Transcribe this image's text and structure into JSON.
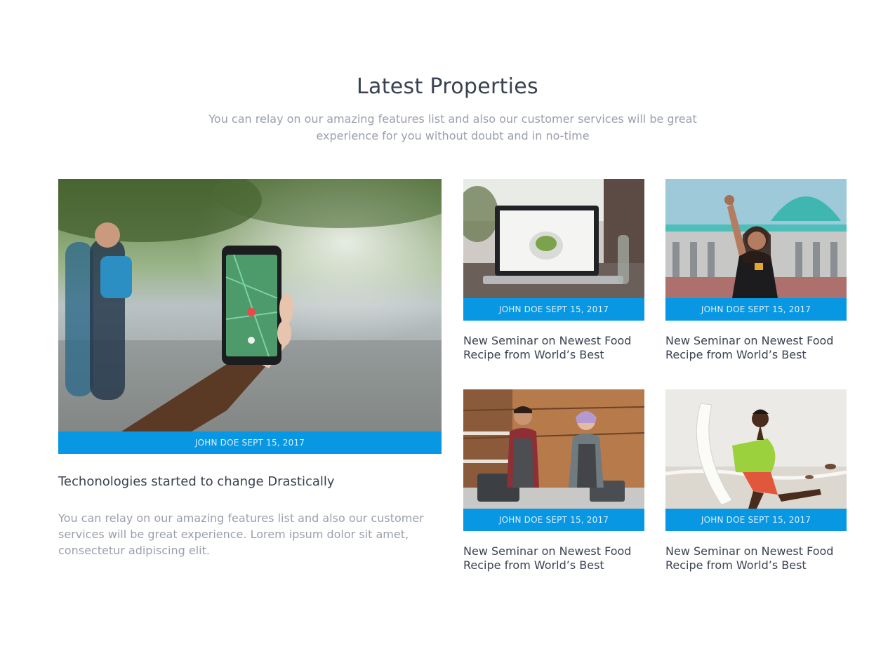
{
  "section": {
    "title": "Latest Properties",
    "subtitle": "You can relay on our amazing features list and also our customer services will be great experience for you without doubt and in no-time"
  },
  "featured": {
    "meta": "JOHN DOE SEPT 15, 2017",
    "title": "Techonologies started to change Drastically",
    "description": "You can relay on our amazing features list and also our customer services will be great experience. Lorem ipsum dolor sit amet, consectetur adipiscing elit."
  },
  "cards": [
    {
      "meta": "JOHN DOE SEPT 15, 2017",
      "title": "New Seminar on Newest Food Recipe from World’s Best"
    },
    {
      "meta": "JOHN DOE SEPT 15, 2017",
      "title": "New Seminar on Newest Food Recipe from World’s Best"
    },
    {
      "meta": "JOHN DOE SEPT 15, 2017",
      "title": "New Seminar on Newest Food Recipe from World’s Best"
    },
    {
      "meta": "JOHN DOE SEPT 15, 2017",
      "title": "New Seminar on Newest Food Recipe from World’s Best"
    }
  ],
  "colors": {
    "accent": "#0797e3",
    "heading": "#3a4150",
    "muted": "#9aa0ab"
  }
}
